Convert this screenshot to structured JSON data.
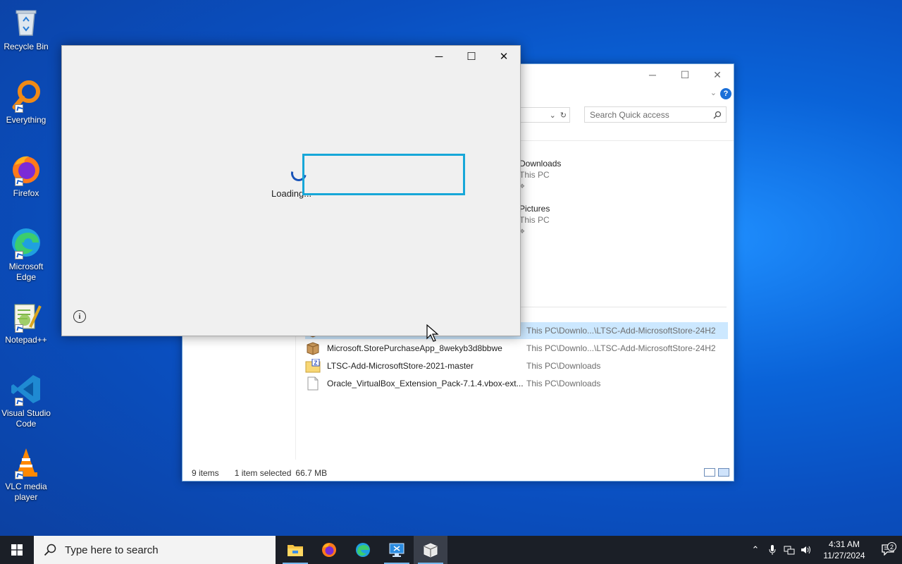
{
  "desktop": {
    "icons": [
      {
        "label": "Recycle Bin"
      },
      {
        "label": "Everything"
      },
      {
        "label": "Firefox"
      },
      {
        "label": "Microsoft Edge"
      },
      {
        "label": "Notepad++"
      },
      {
        "label": "Visual Studio Code"
      },
      {
        "label": "VLC media player"
      }
    ]
  },
  "loader_window": {
    "loading_text": "Loading...",
    "minimize": "─",
    "maximize": "☐",
    "close": "✕",
    "info_glyph": "i"
  },
  "explorer": {
    "minimize": "─",
    "maximize": "☐",
    "close": "✕",
    "help_glyph": "?",
    "search_placeholder": "Search Quick access",
    "quick_access": [
      {
        "name": "Downloads",
        "location": "This PC"
      },
      {
        "name": "Pictures",
        "location": "This PC"
      }
    ],
    "files": [
      {
        "name": "",
        "location": "This PC\\Downlo...\\LTSC-Add-MicrosoftStore-24H2",
        "selected": true,
        "icon": "package-icon"
      },
      {
        "name": "Microsoft.StorePurchaseApp_8wekyb3d8bbwe",
        "location": "This PC\\Downlo...\\LTSC-Add-MicrosoftStore-24H2",
        "selected": false,
        "icon": "package-icon"
      },
      {
        "name": "LTSC-Add-MicrosoftStore-2021-master",
        "location": "This PC\\Downloads",
        "selected": false,
        "icon": "zip-folder-icon"
      },
      {
        "name": "Oracle_VirtualBox_Extension_Pack-7.1.4.vbox-ext...",
        "location": "This PC\\Downloads",
        "selected": false,
        "icon": "blank-file-icon"
      }
    ],
    "status": {
      "item_count": "9 items",
      "selected": "1 item selected",
      "size": "66.7 MB"
    }
  },
  "taskbar": {
    "search_placeholder": "Type here to search",
    "apps": [
      "file-explorer-icon",
      "firefox-icon",
      "edge-icon",
      "remote-desktop-icon",
      "package-app-icon"
    ],
    "clock_time": "4:31 AM",
    "clock_date": "11/27/2024",
    "notification_count": "2"
  },
  "colors": {
    "highlight_border": "#17a7d8",
    "selection_bg": "#cce8ff",
    "taskbar_bg": "#1b1f27"
  }
}
